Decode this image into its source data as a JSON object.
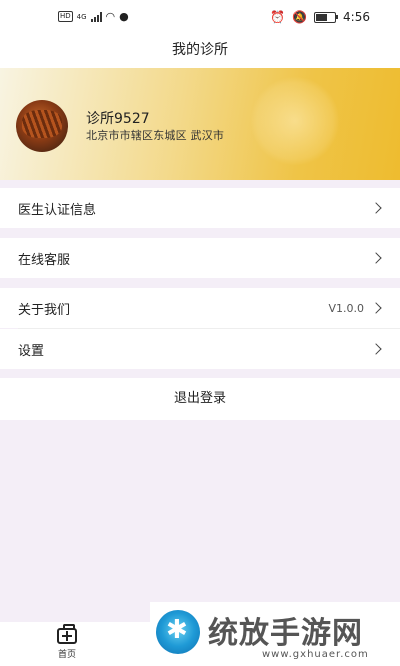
{
  "status_bar": {
    "hd_label": "HD",
    "network_label": "4G",
    "time": "4:56"
  },
  "header": {
    "title": "我的诊所"
  },
  "profile": {
    "name": "诊所9527",
    "address": "北京市市辖区东城区 武汉市"
  },
  "menu": {
    "doctor_cert": "医生认证信息",
    "online_service": "在线客服",
    "about": "关于我们",
    "version": "V1.0.0",
    "settings": "设置"
  },
  "logout_label": "退出登录",
  "tabbar": {
    "home_label": "首页"
  },
  "watermark": {
    "title": "统放手游网",
    "url": "www.gxhuaer.com"
  },
  "colors": {
    "hero_gradient_end": "#eebc2f",
    "page_bg": "#f4eef7"
  }
}
